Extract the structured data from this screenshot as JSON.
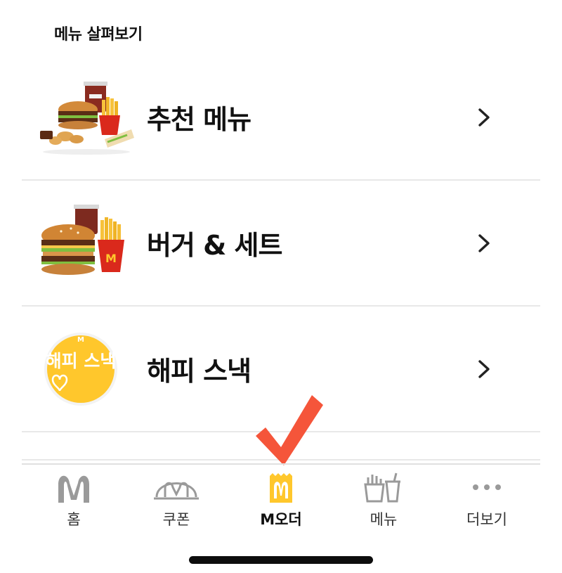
{
  "section_title": "메뉴 살펴보기",
  "menu_items": [
    {
      "label": "추천 메뉴"
    },
    {
      "label": "버거 & 세트"
    },
    {
      "label": "해피 스낵",
      "badge": "해피 스낵"
    }
  ],
  "tabs": [
    {
      "label": "홈",
      "icon": "golden-arches-icon"
    },
    {
      "label": "쿠폰",
      "icon": "coupon-icon"
    },
    {
      "label": "M오더",
      "icon": "m-order-bag-icon",
      "active": true
    },
    {
      "label": "메뉴",
      "icon": "fries-drink-icon"
    },
    {
      "label": "더보기",
      "icon": "more-dots-icon"
    }
  ],
  "colors": {
    "accent_yellow": "#FFC72C",
    "mcd_red": "#DA291C",
    "annotation_check": "#F5553A",
    "tab_icon_gray": "#9a9a9a"
  }
}
